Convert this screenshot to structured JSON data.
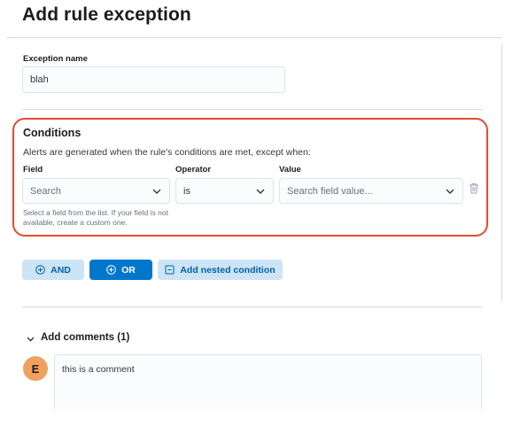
{
  "header": {
    "title": "Add rule exception"
  },
  "exception_name": {
    "label": "Exception name",
    "value": "blah"
  },
  "conditions": {
    "title": "Conditions",
    "description": "Alerts are generated when the rule's conditions are met, except when:",
    "field": {
      "label": "Field",
      "placeholder": "Search",
      "help": "Select a field from the list. If your field is not available, create a custom one."
    },
    "operator": {
      "label": "Operator",
      "value": "is"
    },
    "value": {
      "label": "Value",
      "placeholder": "Search field value..."
    }
  },
  "actions": {
    "and_label": "AND",
    "or_label": "OR",
    "nested_label": "Add nested condition"
  },
  "comments": {
    "title": "Add comments (1)",
    "avatar_initial": "E",
    "text": "this is a comment"
  },
  "colors": {
    "highlight": "#e34b34",
    "primary": "#0077cc",
    "light_button": "#cce4f5",
    "avatar": "#f1a05f"
  },
  "icons": {
    "chevron": "chevron-down-icon",
    "trash": "trash-icon",
    "plus": "plus-in-circle-icon",
    "nested": "nested-icon",
    "collapse": "chevron-down-icon"
  }
}
